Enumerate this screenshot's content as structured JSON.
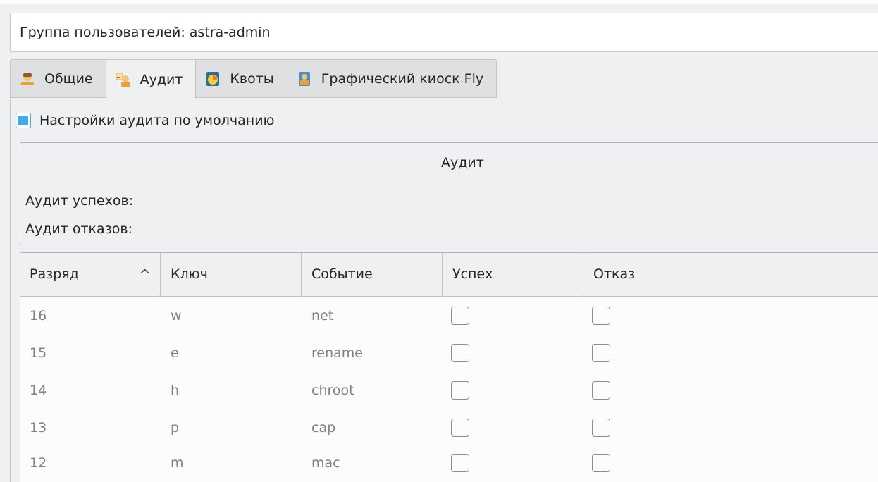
{
  "header": {
    "title": "Группа пользователей: astra-admin"
  },
  "tabs": [
    {
      "label": "Общие",
      "icon": "user-group-icon",
      "active": false
    },
    {
      "label": "Аудит",
      "icon": "audit-icon",
      "active": true
    },
    {
      "label": "Квоты",
      "icon": "quota-icon",
      "active": false
    },
    {
      "label": "Графический киоск Fly",
      "icon": "kiosk-icon",
      "active": false
    }
  ],
  "defaults": {
    "label": "Настройки аудита по умолчанию",
    "checked": true
  },
  "audit_group": {
    "title": "Аудит",
    "success_label": "Аудит успехов:",
    "failure_label": "Аудит отказов:"
  },
  "table": {
    "columns": [
      "Разряд",
      "Ключ",
      "Событие",
      "Успех",
      "Отказ"
    ],
    "sort_indicator": "^",
    "rows": [
      {
        "bit": "16",
        "key": "w",
        "event": "net",
        "success": false,
        "failure": false
      },
      {
        "bit": "15",
        "key": "e",
        "event": "rename",
        "success": false,
        "failure": false
      },
      {
        "bit": "14",
        "key": "h",
        "event": "chroot",
        "success": false,
        "failure": false
      },
      {
        "bit": "13",
        "key": "p",
        "event": "cap",
        "success": false,
        "failure": false
      },
      {
        "bit": "12",
        "key": "m",
        "event": "mac",
        "success": false,
        "failure": false
      }
    ]
  },
  "colors": {
    "accent": "#3daee9",
    "background": "#eff0f1",
    "text": "#232627",
    "muted_text": "#7f8183"
  }
}
